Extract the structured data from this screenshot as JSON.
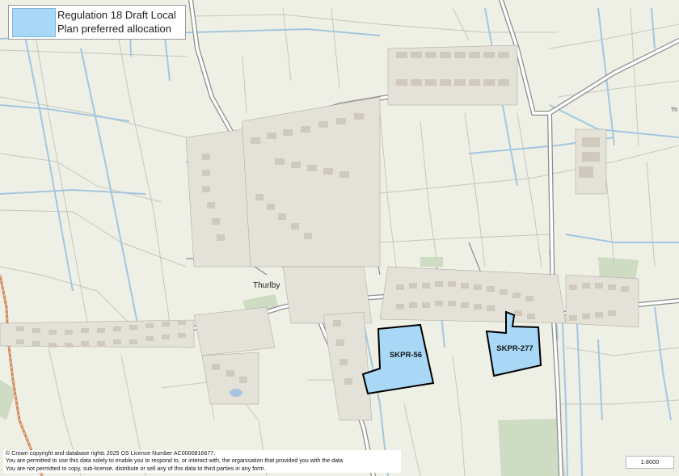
{
  "legend": {
    "line1": "Regulation 18 Draft Local",
    "line2": "Plan preferred allocation",
    "fill_color": "#a9d8f7",
    "border_color": "#000000"
  },
  "places": {
    "village": "Thurlby",
    "village_right_cut": "Th"
  },
  "sites": [
    {
      "id": "SKPR-56"
    },
    {
      "id": "SKPR-277"
    }
  ],
  "copyright": {
    "line1": "© Crown copyright and database rights 2025 OS Licence Number AC0000816677.",
    "line2": "You are permitted to use this data solely to enable you to respond to, or interact with, the organisation that provided you with the data.",
    "line3": "You are not permitted to copy, sub-license, distribute or sell any of this data to third parties in any form."
  },
  "scale": "1:8000",
  "colors": {
    "background": "#eef0e6",
    "road": "#ffffff",
    "road_casing": "#8c8c8c",
    "drain": "#a6c6de",
    "railway": "#cf8a5a",
    "building": "#d7d2c8",
    "field_boundary": "#c9cbbf",
    "green": "#cfdcc4"
  }
}
